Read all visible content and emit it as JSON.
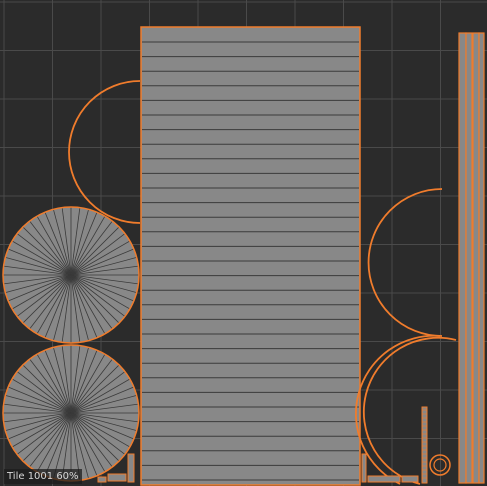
{
  "editor": {
    "tile_label": "Tile 1001 60%"
  },
  "colors": {
    "background": "#2b2b2b",
    "grid": "#4a4a4a",
    "uv_fill": "#888888",
    "uv_edge": "#f07c2c",
    "inner_edge": "#3a3a3a"
  },
  "uv_islands": [
    {
      "name": "wide-strip",
      "type": "ruled-rectangle"
    },
    {
      "name": "disc-top",
      "type": "fan-circle"
    },
    {
      "name": "disc-bottom",
      "type": "fan-circle"
    },
    {
      "name": "arc-left",
      "type": "arc"
    },
    {
      "name": "arc-right-top",
      "type": "arc"
    },
    {
      "name": "arc-right-bottom",
      "type": "arc"
    },
    {
      "name": "thin-strips",
      "type": "thin-rectangles"
    },
    {
      "name": "small-pieces",
      "type": "misc"
    }
  ]
}
